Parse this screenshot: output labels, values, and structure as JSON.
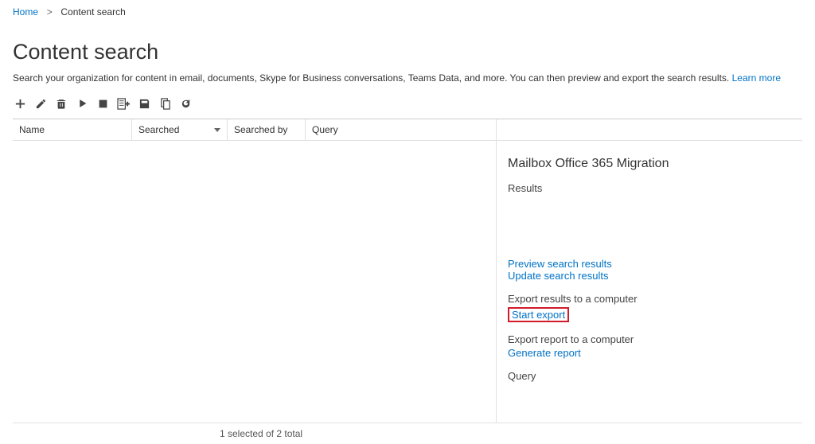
{
  "breadcrumb": {
    "home": "Home",
    "current": "Content search"
  },
  "page_title": "Content search",
  "description_text": "Search your organization for content in email, documents, Skype for Business conversations, Teams Data, and more. You can then preview and export the search results.",
  "learn_more": "Learn more",
  "toolbar_icons": [
    "add-icon",
    "edit-icon",
    "delete-icon",
    "play-icon",
    "stop-icon",
    "list-new-icon",
    "save-icon",
    "copy-icon",
    "refresh-icon"
  ],
  "columns": {
    "name": "Name",
    "searched": "Searched",
    "searched_by": "Searched by",
    "query": "Query"
  },
  "details": {
    "title": "Mailbox Office 365 Migration",
    "results_label": "Results",
    "preview": "Preview search results",
    "update": "Update search results",
    "export_results_label": "Export results to a computer",
    "start_export": "Start export",
    "export_report_label": "Export report to a computer",
    "generate_report": "Generate report",
    "query_label": "Query"
  },
  "status": "1 selected of 2 total"
}
